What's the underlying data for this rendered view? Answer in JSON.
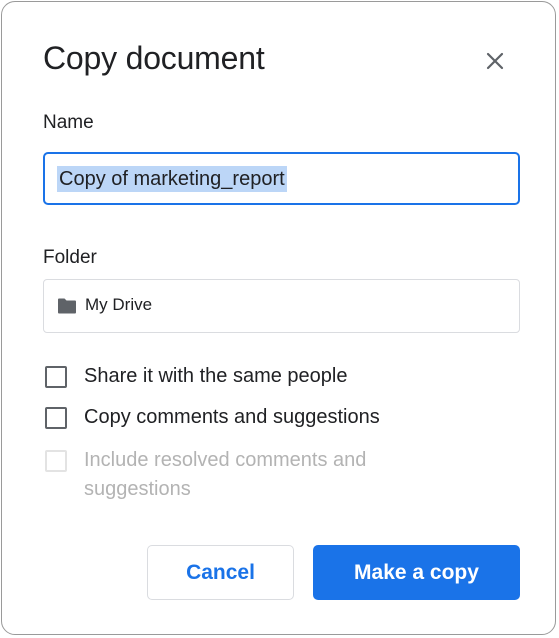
{
  "dialog": {
    "title": "Copy document",
    "close_icon": "close-icon"
  },
  "name_field": {
    "label": "Name",
    "value": "Copy of marketing_report"
  },
  "folder_field": {
    "label": "Folder",
    "icon": "folder-icon",
    "value": "My Drive"
  },
  "options": {
    "share": {
      "label": "Share it with the same people",
      "checked": false,
      "disabled": false
    },
    "comments": {
      "label": "Copy comments and suggestions",
      "checked": false,
      "disabled": false
    },
    "resolved": {
      "label": "Include resolved comments and suggestions",
      "checked": false,
      "disabled": true
    }
  },
  "buttons": {
    "cancel": "Cancel",
    "make_copy": "Make a copy"
  },
  "colors": {
    "accent": "#1a73e8",
    "selection_highlight": "#bcd6f7",
    "disabled_text": "#b3b3b3"
  }
}
